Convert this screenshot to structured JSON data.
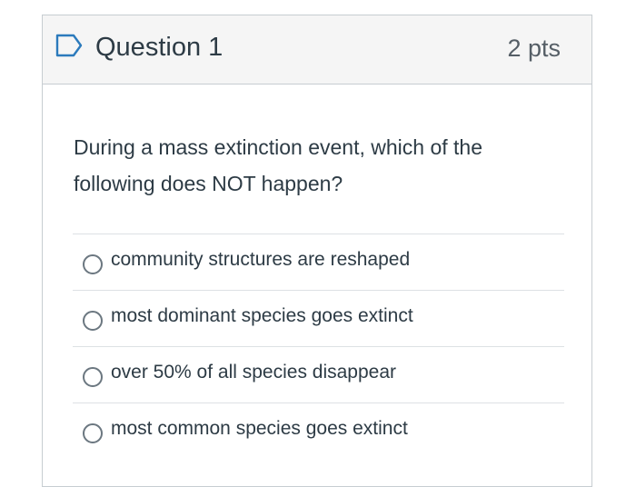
{
  "question": {
    "title": "Question 1",
    "points": "2 pts",
    "flag_icon": "bookmark-flag-icon",
    "text": "During a mass extinction event, which of the following does NOT happen?"
  },
  "answers": [
    {
      "label": "community structures are reshaped",
      "selected": false
    },
    {
      "label": "most dominant species goes extinct",
      "selected": false
    },
    {
      "label": "over 50% of all species disappear",
      "selected": false
    },
    {
      "label": "most common species goes extinct",
      "selected": false
    }
  ],
  "colors": {
    "accent": "#2b7abc",
    "text": "#2d3b45",
    "border": "#c7cdd1"
  }
}
